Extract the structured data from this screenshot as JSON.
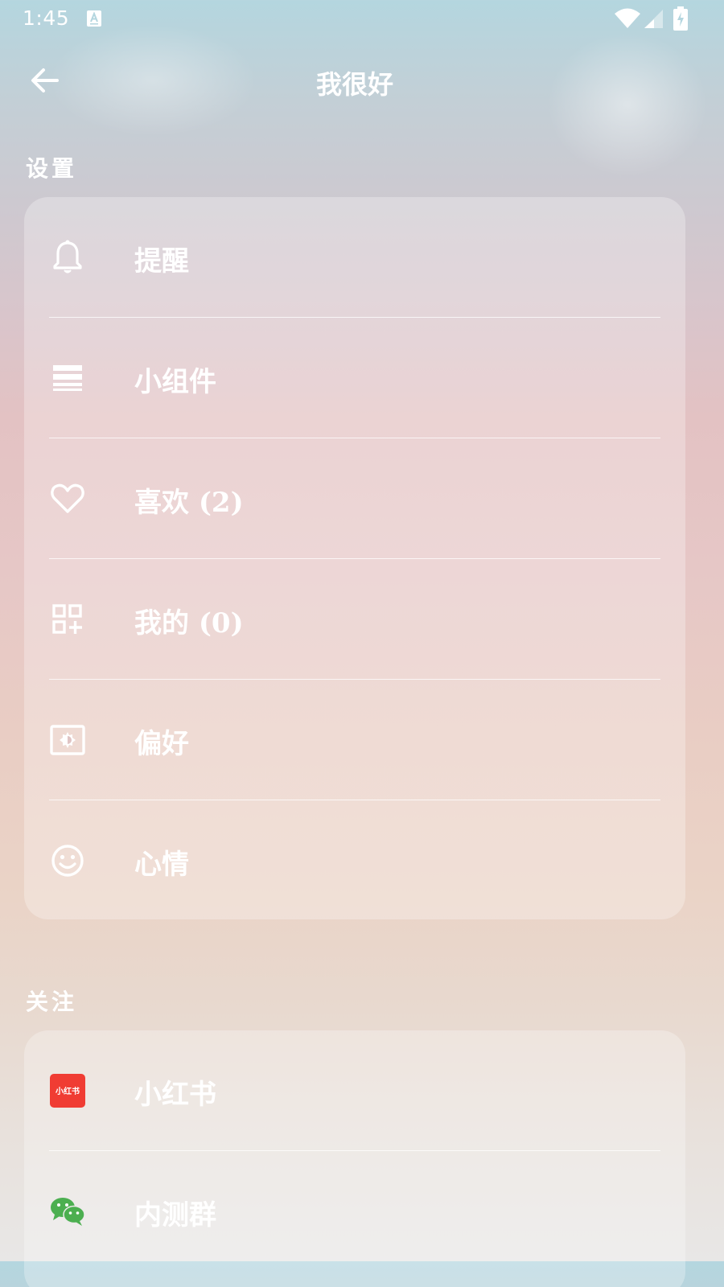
{
  "status_bar": {
    "time": "1:45",
    "icons": [
      "text-app-icon",
      "wifi-icon",
      "cell-signal-icon",
      "battery-charging-icon"
    ]
  },
  "header": {
    "title": "我很好",
    "back_icon": "arrow-left-icon"
  },
  "settings": {
    "label": "设置",
    "items": [
      {
        "label": "提醒",
        "icon": "bell-icon"
      },
      {
        "label": "小组件",
        "icon": "widget-list-icon"
      },
      {
        "label": "喜欢 (2)",
        "icon": "heart-icon"
      },
      {
        "label": "我的 (0)",
        "icon": "grid-add-icon"
      },
      {
        "label": "偏好",
        "icon": "brightness-settings-icon"
      },
      {
        "label": "心情",
        "icon": "smiley-icon"
      }
    ]
  },
  "follow": {
    "label": "关注",
    "items": [
      {
        "label": "小红书",
        "icon": "xiaohongshu-icon",
        "icon_text": "小红书",
        "icon_color": "#f03c33"
      },
      {
        "label": "内测群",
        "icon": "wechat-icon",
        "icon_color": "#4caf50"
      }
    ]
  }
}
